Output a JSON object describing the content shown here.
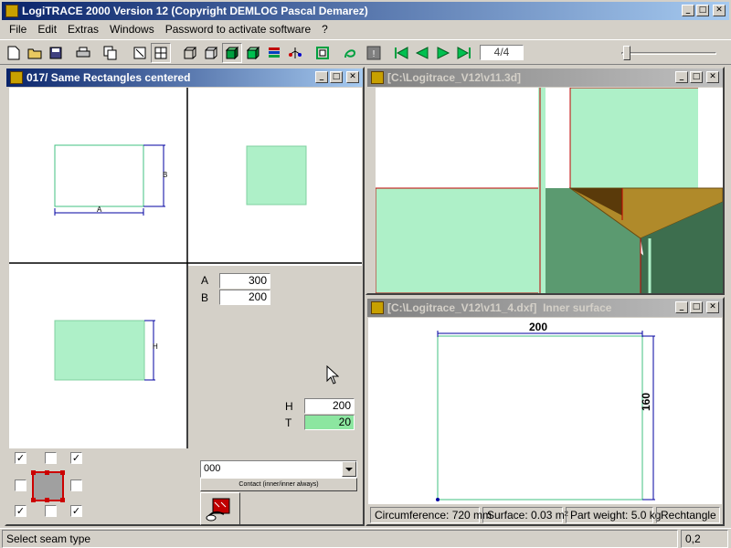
{
  "app": {
    "title": "LogiTRACE 2000  Version 12  (Copyright DEMLOG Pascal Demarez)"
  },
  "menu": [
    "File",
    "Edit",
    "Extras",
    "Windows",
    "Password to activate software",
    "?"
  ],
  "toolbar": {
    "page_indicator": "4/4",
    "icons": [
      "new-icon",
      "open-icon",
      "save-icon",
      "print-icon",
      "copy-icon",
      "page-icon",
      "layout-icon",
      "box-icon",
      "box-outline-icon",
      "box-filled-icon",
      "cube-green-icon",
      "flags-icon",
      "tree-icon",
      "frame-icon",
      "lasso-icon",
      "info-icon",
      "first-icon",
      "prev-icon",
      "next-icon",
      "last-icon"
    ]
  },
  "window_main": {
    "title": "017/ Same Rectangles centered",
    "dim_a_label": "A",
    "dim_b_label": "B",
    "dim_h_label": "H",
    "param_a_label": "A",
    "param_a_value": "300",
    "param_b_label": "B",
    "param_b_value": "200",
    "param_h_label": "H",
    "param_h_value": "200",
    "param_t_label": "T",
    "param_t_value": "20",
    "seam_select_value": "000",
    "contact_button": "Contact (inner/inner always)",
    "checkboxes": [
      true,
      false,
      true,
      false,
      false,
      true,
      false,
      true
    ]
  },
  "window_3d": {
    "title": "[C:\\Logitrace_V12\\v11.3d]"
  },
  "window_dxf": {
    "title": "[C:\\Logitrace_V12\\v11_4.dxf]  Inner surface",
    "width_label": "200",
    "height_label": "160",
    "circumference": "Circumference: 720 mm",
    "surface": "Surface: 0.03 m²",
    "part_weight": "Part weight: 5.0 kg",
    "shape": "Rechtangle"
  },
  "status": {
    "message": "Select seam type",
    "value": "0,2"
  },
  "colors": {
    "title_active": "#0a246a",
    "face_light": "#aef0c8",
    "face_dark": "#3d6e4e",
    "face_brown": "#b08a2a",
    "field_green": "#8ce6a0",
    "dim_blue": "#0000a0"
  }
}
